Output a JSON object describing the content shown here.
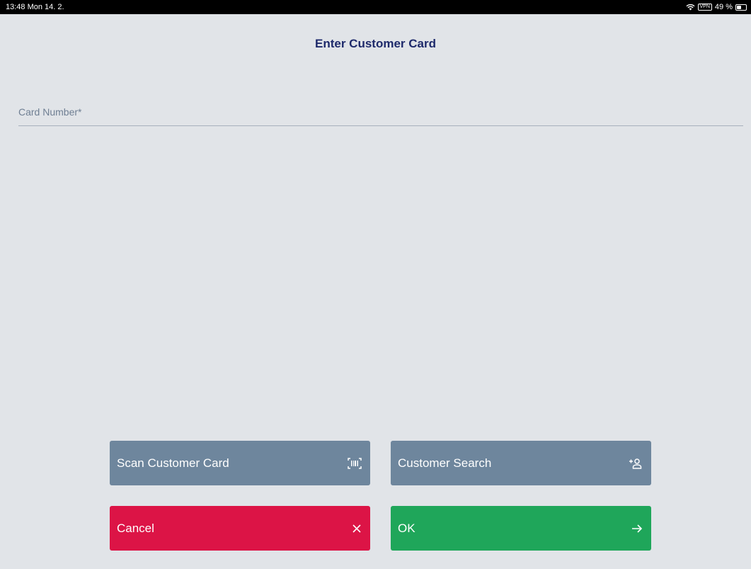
{
  "status_bar": {
    "time_date": "13:48  Mon 14. 2.",
    "vpn_label": "VPN",
    "battery_text": "49 %",
    "battery_level": 0.49
  },
  "page": {
    "title": "Enter Customer Card"
  },
  "form": {
    "card_number_label": "Card Number*",
    "card_number_value": ""
  },
  "buttons": {
    "scan_label": "Scan Customer Card",
    "scan_icon": "barcode-scan-icon",
    "search_label": "Customer Search",
    "search_icon": "add-person-icon",
    "cancel_label": "Cancel",
    "cancel_icon": "close-icon",
    "ok_label": "OK",
    "ok_icon": "arrow-right-icon"
  },
  "colors": {
    "background": "#e1e4e8",
    "title": "#1e2a6b",
    "secondary_button": "#6e869d",
    "cancel_button": "#dc1446",
    "ok_button": "#1fa65a"
  }
}
